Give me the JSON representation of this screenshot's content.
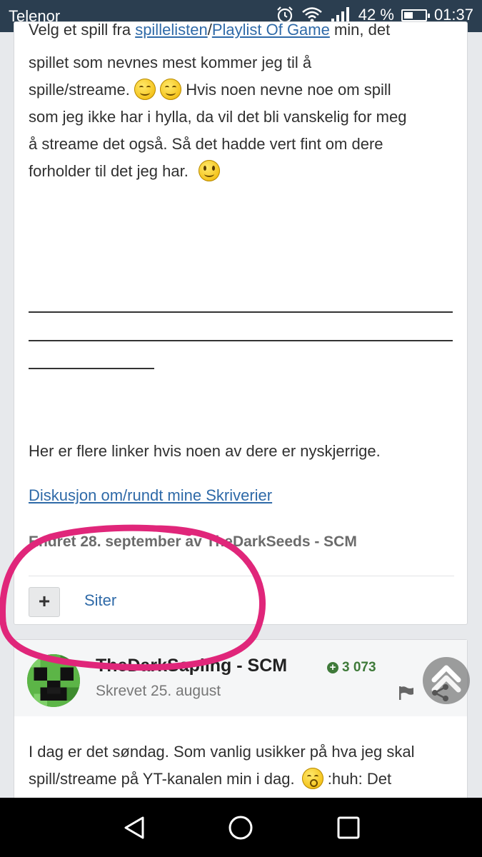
{
  "status_bar": {
    "carrier": "Telenor",
    "battery_percent": "42 %",
    "battery_level": 0.42,
    "time": "01:37",
    "icons": [
      "alarm-icon",
      "wifi-icon",
      "signal-icon",
      "battery-icon"
    ]
  },
  "post1": {
    "line1": {
      "prefix": "Velg et spill fra ",
      "link1": "spillelisten",
      "sep": "/",
      "link2": "Playlist Of Game",
      "suffix": " min, det"
    },
    "line2": "spillet som nevnes mest kommer jeg til å",
    "line3_prefix": "spille/streame.",
    "line3_suffix": "Hvis noen nevne noe om spill",
    "line4": "som jeg ikke har i hylla, da vil det bli vanskelig for meg",
    "line5": "å streame det også. Så det hadde vert fint om dere",
    "line6": "forholder til det jeg har.",
    "more_links_text": "Her er flere linker hvis noen av dere er nyskjerrige.",
    "discussion_link": "Diskusjon om/rundt mine Skriverier",
    "edited_note": "Endret 28. september av TheDarkSeeds - SCM",
    "plus_label": "+",
    "quote_label": "Siter"
  },
  "post2": {
    "author": "TheDarkSapling - SCM",
    "reputation": "3 073",
    "date": "Skrevet 25. august",
    "body_line1": "I dag er det søndag. Som vanlig usikker på hva jeg skal",
    "body_line2_prefix": "spill/streame på YT-kanalen min i dag.",
    "body_line2_suffix": " :huh:  Det"
  },
  "colors": {
    "link": "#2f6aa8",
    "status_bar": "#2b3e50",
    "annotation": "#e0267a",
    "reputation": "#3f7a3a"
  }
}
